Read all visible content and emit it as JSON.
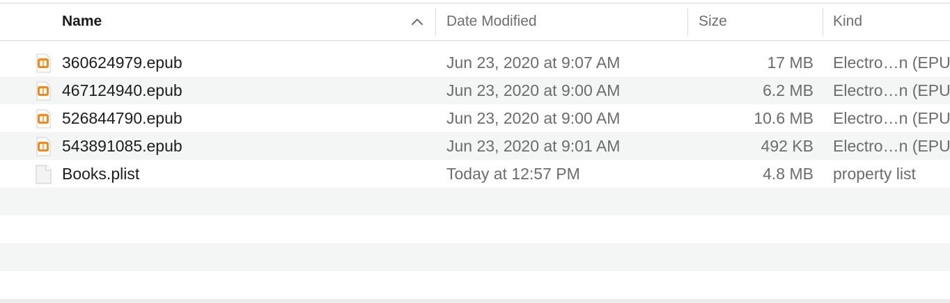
{
  "columns": {
    "name": "Name",
    "date_modified": "Date Modified",
    "size": "Size",
    "kind": "Kind"
  },
  "sort": {
    "column": "name",
    "direction": "ascending"
  },
  "files": [
    {
      "name": "360624979.epub",
      "date": "Jun 23, 2020 at 9:07 AM",
      "size": "17 MB",
      "kind": "Electro…n (EPUB)",
      "icon": "epub-icon"
    },
    {
      "name": "467124940.epub",
      "date": "Jun 23, 2020 at 9:00 AM",
      "size": "6.2 MB",
      "kind": "Electro…n (EPUB)",
      "icon": "epub-icon"
    },
    {
      "name": "526844790.epub",
      "date": "Jun 23, 2020 at 9:00 AM",
      "size": "10.6 MB",
      "kind": "Electro…n (EPUB)",
      "icon": "epub-icon"
    },
    {
      "name": "543891085.epub",
      "date": "Jun 23, 2020 at 9:01 AM",
      "size": "492 KB",
      "kind": "Electro…n (EPUB)",
      "icon": "epub-icon"
    },
    {
      "name": "Books.plist",
      "date": "Today at 12:57 PM",
      "size": "4.8 MB",
      "kind": "property list",
      "icon": "document-icon"
    }
  ],
  "colors": {
    "epub_accent": "#f08a1c",
    "row_alt": "#f4f5f5"
  }
}
